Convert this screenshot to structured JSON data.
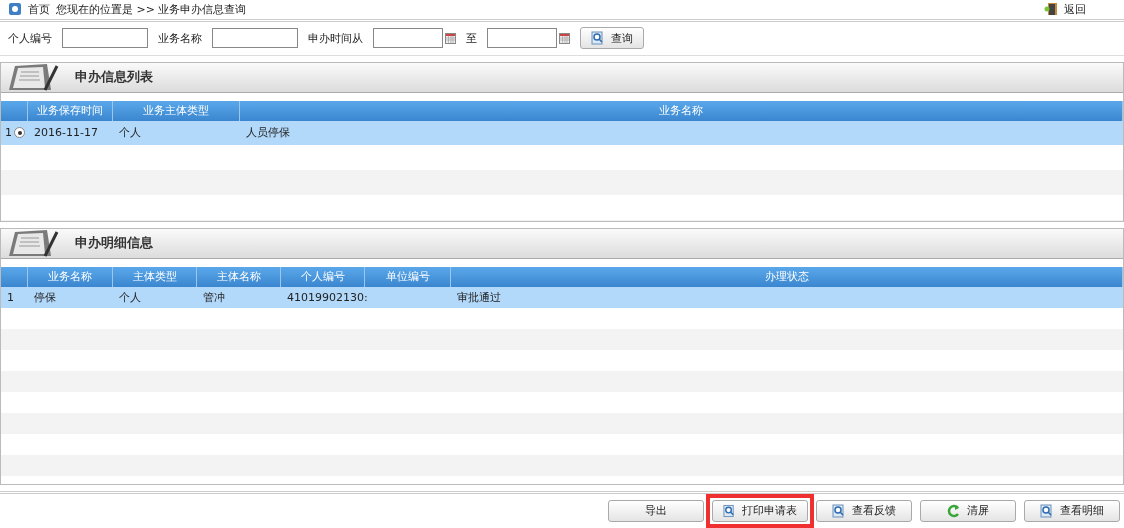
{
  "breadcrumb": {
    "home": "首页",
    "location": "您现在的位置是 >> 业务申办信息查询",
    "back": "返回"
  },
  "search": {
    "fields": [
      {
        "label": "个人编号",
        "kind": "text"
      },
      {
        "label": "业务名称",
        "kind": "text"
      },
      {
        "label": "申办时间从",
        "kind": "date"
      },
      {
        "label": "至",
        "kind": "date"
      }
    ],
    "button": "查询"
  },
  "list_section": {
    "title": "申办信息列表",
    "columns": [
      "业务保存时间",
      "业务主体类型",
      "业务名称"
    ],
    "rows": [
      {
        "index": "1",
        "selected": true,
        "cells": [
          "2016-11-17",
          "个人",
          "人员停保"
        ]
      }
    ]
  },
  "detail_section": {
    "title": "申办明细信息",
    "columns": [
      "业务名称",
      "主体类型",
      "主体名称",
      "个人编号",
      "单位编号",
      "办理状态"
    ],
    "rows": [
      {
        "index": "1",
        "cells": [
          "停保",
          "个人",
          "管冲",
          "41019902130:",
          "",
          "审批通过"
        ]
      }
    ]
  },
  "buttons": [
    {
      "label": "导出",
      "kind": "plain",
      "highlighted": false
    },
    {
      "label": "打印申请表",
      "kind": "view",
      "highlighted": true
    },
    {
      "label": "查看反馈",
      "kind": "view",
      "highlighted": false
    },
    {
      "label": "清屏",
      "kind": "reset",
      "highlighted": false
    },
    {
      "label": "查看明细",
      "kind": "view",
      "highlighted": false
    }
  ]
}
